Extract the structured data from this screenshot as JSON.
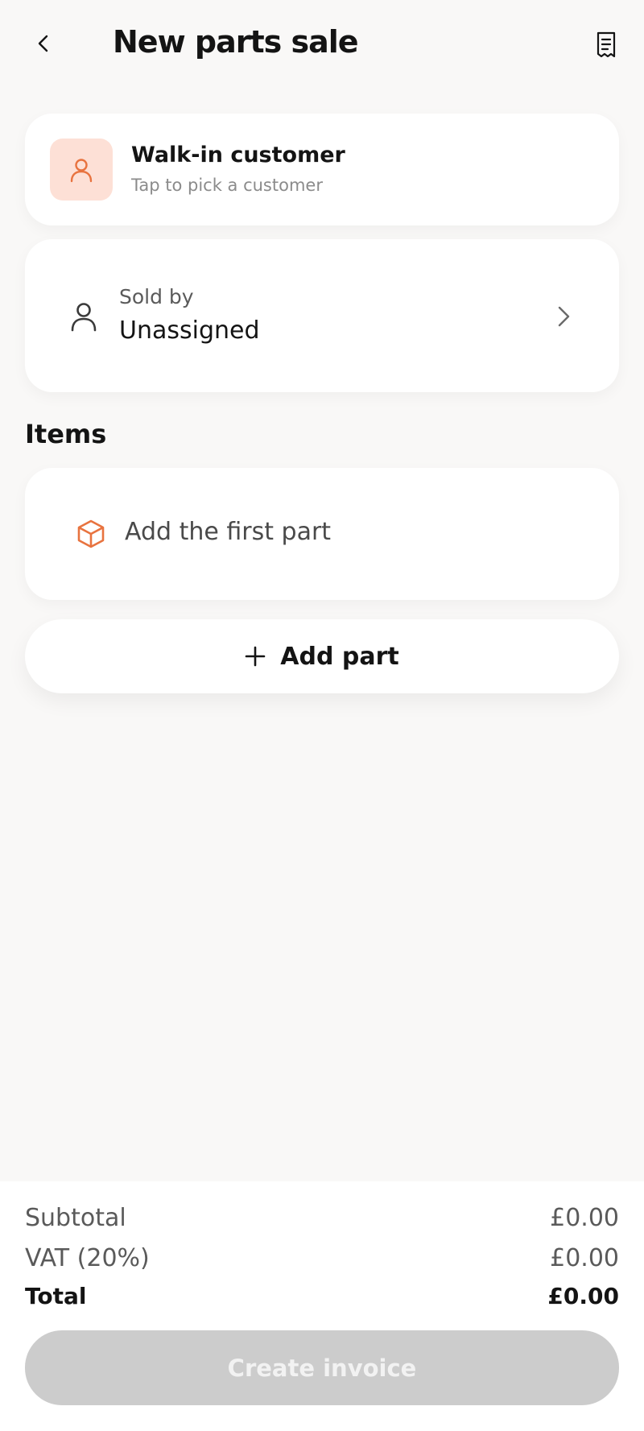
{
  "header": {
    "title": "New parts sale",
    "back_icon": "chevron-left-icon",
    "receipt_icon": "receipt-icon"
  },
  "customer": {
    "name": "Walk-in customer",
    "hint": "Tap to pick a customer",
    "icon": "user-icon"
  },
  "sold_by": {
    "label": "Sold by",
    "value": "Unassigned",
    "icon": "user-icon",
    "chevron": "chevron-right-icon"
  },
  "items": {
    "heading": "Items",
    "empty_label": "Add the first part",
    "empty_icon": "box-icon"
  },
  "add_part": {
    "label": "Add part",
    "icon": "plus-icon"
  },
  "totals": {
    "subtotal_label": "Subtotal",
    "subtotal_value": "£0.00",
    "vat_label": "VAT (20%)",
    "vat_value": "£0.00",
    "total_label": "Total",
    "total_value": "£0.00"
  },
  "create_invoice": {
    "label": "Create invoice",
    "disabled": true
  },
  "colors": {
    "accent": "#e8733f",
    "accent_bg": "#fde0d6",
    "page_bg": "#f9f8f7",
    "button_disabled": "#cccccc"
  }
}
